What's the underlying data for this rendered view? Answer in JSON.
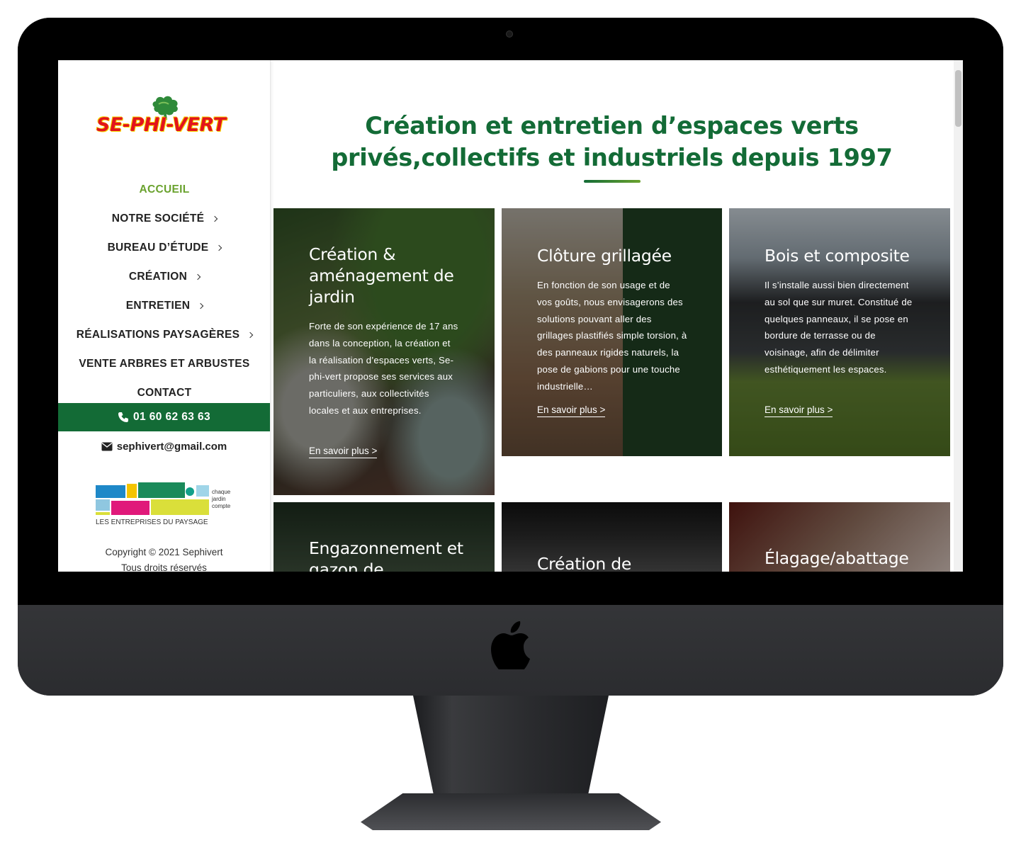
{
  "brand": {
    "name": "SE-PHI-VERT",
    "primary_color": "#136b36",
    "accent_color": "#6aa22e",
    "logo_color": "#e2141c"
  },
  "sidebar": {
    "nav": [
      {
        "label": "ACCUEIL",
        "active": true,
        "has_submenu": false
      },
      {
        "label": "NOTRE SOCIÉTÉ",
        "active": false,
        "has_submenu": true
      },
      {
        "label": "BUREAU D’ÉTUDE",
        "active": false,
        "has_submenu": true
      },
      {
        "label": "CRÉATION",
        "active": false,
        "has_submenu": true
      },
      {
        "label": "ENTRETIEN",
        "active": false,
        "has_submenu": true
      },
      {
        "label": "RÉALISATIONS PAYSAGÈRES",
        "active": false,
        "has_submenu": true
      },
      {
        "label": "VENTE ARBRES ET ARBUSTES",
        "active": false,
        "has_submenu": false
      },
      {
        "label": "CONTACT",
        "active": false,
        "has_submenu": false
      }
    ],
    "phone": "01 60 62 63 63",
    "email": "sephivert@gmail.com",
    "partner_logo": {
      "caption": "LES ENTREPRISES DU PAYSAGE",
      "tagline": [
        "chaque",
        "jardin",
        "compte"
      ]
    },
    "copyright": "Copyright © 2021 Sephivert",
    "rights": "Tous droits réservés"
  },
  "main": {
    "headline_line1": "Création et entretien d’espaces verts",
    "headline_line2": "privés,collectifs et industriels depuis 1997",
    "cards": [
      {
        "title": "Création & aménagement de jardin",
        "text": "Forte de son expérience de 17 ans dans la conception, la création et la réalisation d’espaces verts, Se-phi-vert propose ses services aux particuliers, aux collectivités locales et aux entreprises.",
        "link": "En savoir plus >"
      },
      {
        "title": "Clôture grillagée",
        "text": "En fonction de son usage et de vos goûts, nous envisagerons des solutions pouvant aller des grillages plastifiés simple torsion, à des panneaux rigides naturels, la pose de gabions pour une touche industrielle…",
        "link": "En savoir plus >"
      },
      {
        "title": "Bois et composite",
        "text": "Il s’installe aussi bien directement au sol que sur muret. Constitué de quelques panneaux, il se pose en bordure de terrasse ou de voisinage, afin de délimiter esthétiquement les espaces.",
        "link": "En savoir plus >"
      },
      {
        "title": "Engazonnement et gazon de"
      },
      {
        "title": "Création de"
      },
      {
        "title": "Élagage/abattage"
      }
    ]
  }
}
